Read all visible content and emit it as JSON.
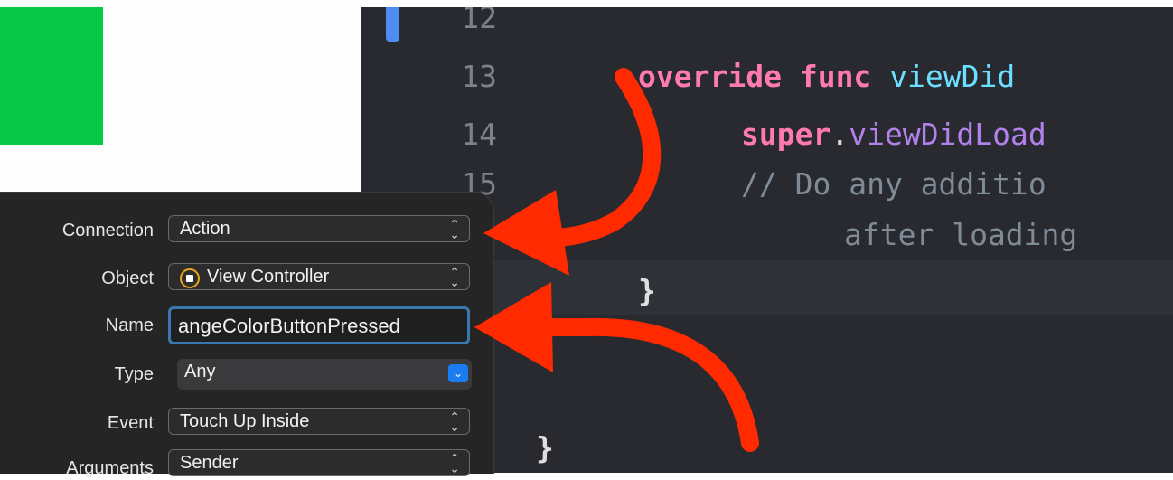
{
  "editor": {
    "lines": [
      {
        "num": "12"
      },
      {
        "num": "13",
        "kw1": "override",
        "kw2": "func",
        "fn": "viewDid"
      },
      {
        "num": "14",
        "kw": "super",
        "dot": ".",
        "meth": "viewDidLoad"
      },
      {
        "num": "15",
        "comment": "// Do any additio"
      },
      {
        "comment_cont": "after loading"
      },
      {
        "brace": "}"
      },
      {
        "brace": "}"
      }
    ]
  },
  "connection_panel": {
    "connection": {
      "label": "Connection",
      "value": "Action"
    },
    "object": {
      "label": "Object",
      "value": "View Controller",
      "icon": "view-controller-icon"
    },
    "name": {
      "label": "Name",
      "value": "angeColorButtonPressed"
    },
    "type": {
      "label": "Type",
      "value": "Any"
    },
    "event": {
      "label": "Event",
      "value": "Touch Up Inside"
    },
    "arguments": {
      "label": "Arguments",
      "value": "Sender"
    }
  },
  "colors": {
    "accent": "#1b7cf2",
    "annotation_arrow": "#ff2a00",
    "green_view": "#07c947"
  }
}
